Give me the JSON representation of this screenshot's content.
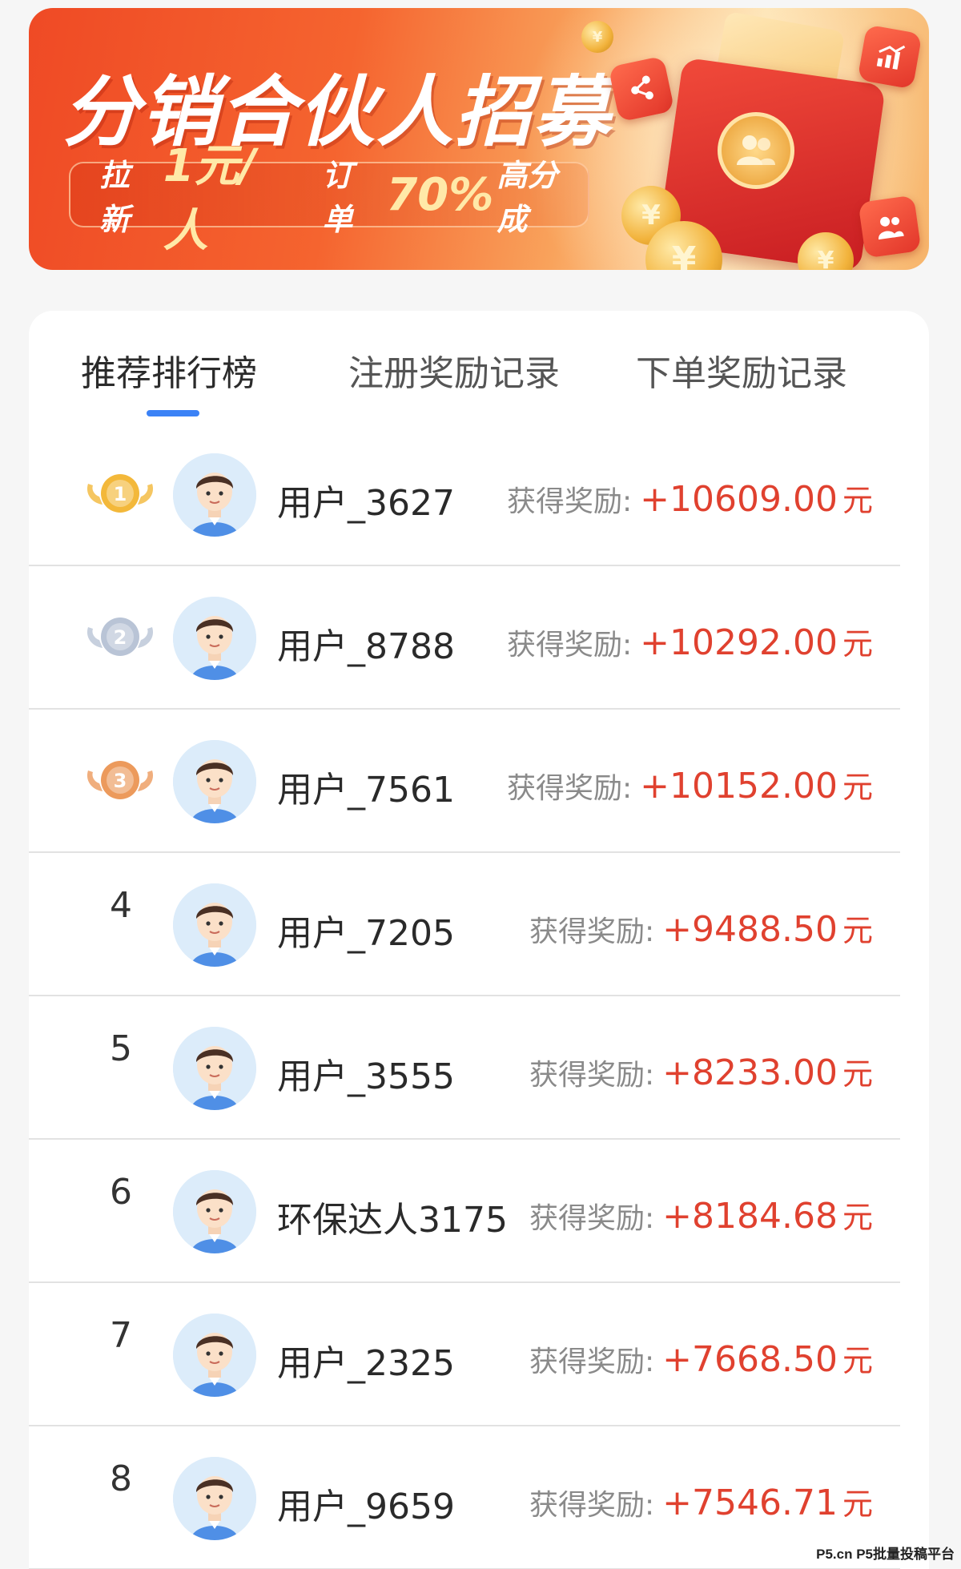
{
  "banner": {
    "title": "分销合伙人招募",
    "pill_part1": "拉新",
    "pill_big1": "1元/人",
    "pill_part2": "订单",
    "pill_big2": "70%",
    "pill_part3": "高分成"
  },
  "tabs": [
    {
      "label": "推荐排行榜",
      "active": true
    },
    {
      "label": "注册奖励记录",
      "active": false
    },
    {
      "label": "下单奖励记录",
      "active": false
    }
  ],
  "reward_label": "获得奖励:",
  "unit": "元",
  "rankings": [
    {
      "rank": "1",
      "name": "用户_3627",
      "amount": "+10609.00"
    },
    {
      "rank": "2",
      "name": "用户_8788",
      "amount": "+10292.00"
    },
    {
      "rank": "3",
      "name": "用户_7561",
      "amount": "+10152.00"
    },
    {
      "rank": "4",
      "name": "用户_7205",
      "amount": "+9488.50"
    },
    {
      "rank": "5",
      "name": "用户_3555",
      "amount": "+8233.00"
    },
    {
      "rank": "6",
      "name": "环保达人3175",
      "amount": "+8184.68"
    },
    {
      "rank": "7",
      "name": "用户_2325",
      "amount": "+7668.50"
    },
    {
      "rank": "8",
      "name": "用户_9659",
      "amount": "+7546.71"
    }
  ],
  "medal_colors": [
    "#f3b83a",
    "#b9c4d6",
    "#ec9a5c"
  ],
  "accent_color": "#3b82f6",
  "reward_color": "#e0412f",
  "watermark": "P5.cn P5批量投稿平台"
}
